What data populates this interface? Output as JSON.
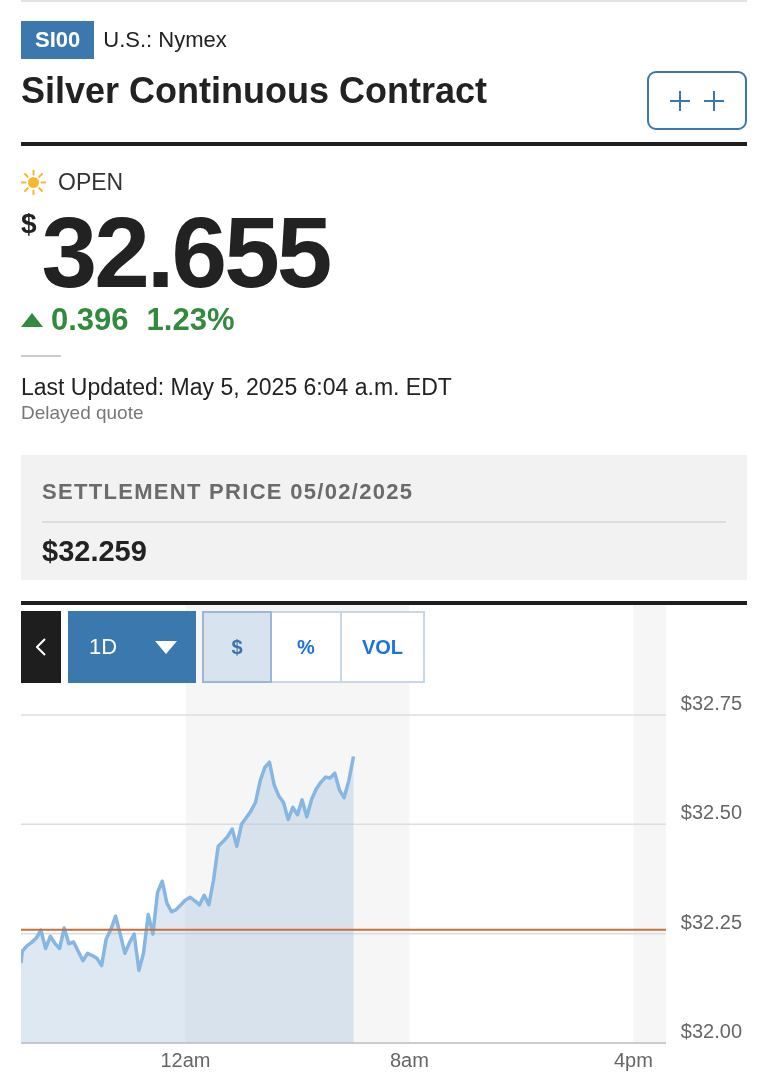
{
  "header": {
    "symbol": "SI00",
    "exchange": "U.S.: Nymex",
    "title": "Silver Continuous Contract"
  },
  "quote": {
    "status": "OPEN",
    "currency": "$",
    "price": "32.655",
    "change": {
      "up": true,
      "amount": "0.396",
      "percent": "1.23%"
    },
    "last_updated": "Last Updated: May 5, 2025 6:04 a.m. EDT",
    "note": "Delayed quote"
  },
  "settlement": {
    "label": "SETTLEMENT PRICE 05/02/2025",
    "value": "$32.259"
  },
  "chart": {
    "toolbar": {
      "period": "1D",
      "tabs": [
        {
          "label": "$",
          "selected": true
        },
        {
          "label": "%",
          "selected": false
        },
        {
          "label": "VOL",
          "selected": false
        }
      ]
    },
    "chart_data": {
      "type": "area",
      "categories": [
        null,
        null,
        null,
        null,
        null,
        null,
        null,
        null,
        null,
        null,
        null,
        null,
        null,
        null,
        null,
        null,
        null,
        null,
        null,
        null,
        null,
        null,
        null,
        null,
        null,
        null,
        null,
        null,
        null,
        null,
        null,
        null,
        null,
        null,
        null,
        null,
        "12am",
        null,
        null,
        null,
        null,
        null,
        null,
        null,
        null,
        null,
        null,
        null,
        null,
        null,
        null,
        null,
        null,
        null,
        null,
        null,
        null,
        null,
        null,
        null,
        null,
        null,
        null,
        null,
        null,
        null,
        null,
        null,
        null,
        null,
        null,
        null,
        null,
        null,
        null,
        null,
        null,
        null,
        null,
        null,
        null,
        null,
        null,
        null,
        "8am",
        null,
        null,
        null,
        null,
        null,
        null,
        null,
        null,
        null,
        null,
        null,
        null,
        null,
        null,
        null,
        null,
        null,
        null,
        null,
        null,
        null,
        null,
        null,
        null,
        null,
        null,
        null,
        null,
        null,
        null,
        null,
        null,
        null,
        null,
        null,
        null,
        null,
        null,
        null,
        null,
        null,
        null,
        null,
        null,
        null,
        null,
        null,
        "4pm",
        null,
        null,
        null,
        null,
        null,
        null,
        null
      ],
      "values": [
        32.183,
        32.21,
        32.222,
        32.23,
        32.24,
        32.258,
        32.216,
        32.244,
        32.228,
        32.216,
        32.263,
        32.227,
        32.231,
        32.21,
        32.188,
        32.205,
        32.2,
        32.194,
        32.177,
        32.238,
        32.26,
        32.29,
        32.249,
        32.205,
        32.23,
        32.249,
        32.166,
        32.205,
        32.294,
        32.249,
        32.344,
        32.37,
        32.32,
        32.3,
        32.305,
        32.316,
        32.327,
        32.333,
        32.325,
        32.316,
        32.338,
        32.316,
        32.372,
        32.45,
        32.46,
        32.472,
        32.489,
        32.45,
        32.5,
        32.515,
        32.53,
        32.55,
        32.6,
        32.63,
        32.642,
        32.59,
        32.565,
        32.55,
        32.511,
        32.539,
        32.522,
        32.556,
        32.517,
        32.556,
        32.58,
        32.596,
        32.608,
        32.606,
        32.617,
        32.578,
        32.561,
        32.6,
        32.655,
        null,
        null,
        null,
        null,
        null,
        null,
        null,
        null,
        null,
        null,
        null,
        null,
        null,
        null,
        null,
        null,
        null,
        null,
        null,
        null,
        null,
        null,
        null,
        null,
        null,
        null,
        null,
        null,
        null,
        null,
        null,
        null,
        null,
        null,
        null,
        null,
        null,
        null,
        null,
        null,
        null,
        null,
        null,
        null,
        null,
        null,
        null,
        null,
        null,
        null,
        null,
        null,
        null,
        null,
        null,
        null,
        null,
        null,
        null,
        null,
        null,
        null,
        null,
        null,
        null,
        null,
        null
      ],
      "ylim": [
        32,
        32.75
      ],
      "yticks": [
        {
          "value": 32,
          "label": "$32.00"
        },
        {
          "value": 32.25,
          "label": "$32.25"
        },
        {
          "value": 32.5,
          "label": "$32.50"
        },
        {
          "value": 32.75,
          "label": "$32.75"
        }
      ],
      "grid": true,
      "ref_lines": [
        {
          "axis": "y",
          "value": 32.259,
          "color": "#c8703a"
        }
      ]
    }
  }
}
